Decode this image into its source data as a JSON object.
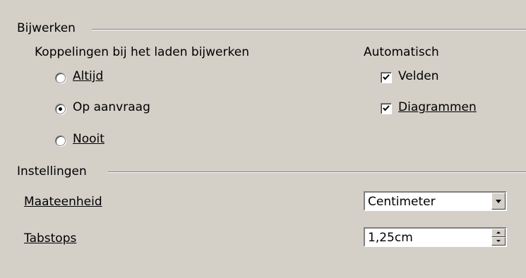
{
  "update_section": {
    "title": "Bijwerken",
    "links_group_label": "Koppelingen bij het laden bijwerken",
    "options": [
      {
        "label": "Altijd",
        "selected": false
      },
      {
        "label": "Op aanvraag",
        "selected": true
      },
      {
        "label": "Nooit",
        "selected": false
      }
    ],
    "auto_label": "Automatisch",
    "checks": [
      {
        "label": "Velden",
        "checked": true
      },
      {
        "label": "Diagrammen",
        "checked": true
      }
    ]
  },
  "settings_section": {
    "title": "Instellingen",
    "unit_label": "Maateenheid",
    "unit_value": "Centimeter",
    "tabstops_label": "Tabstops",
    "tabstops_value": "1,25cm"
  }
}
